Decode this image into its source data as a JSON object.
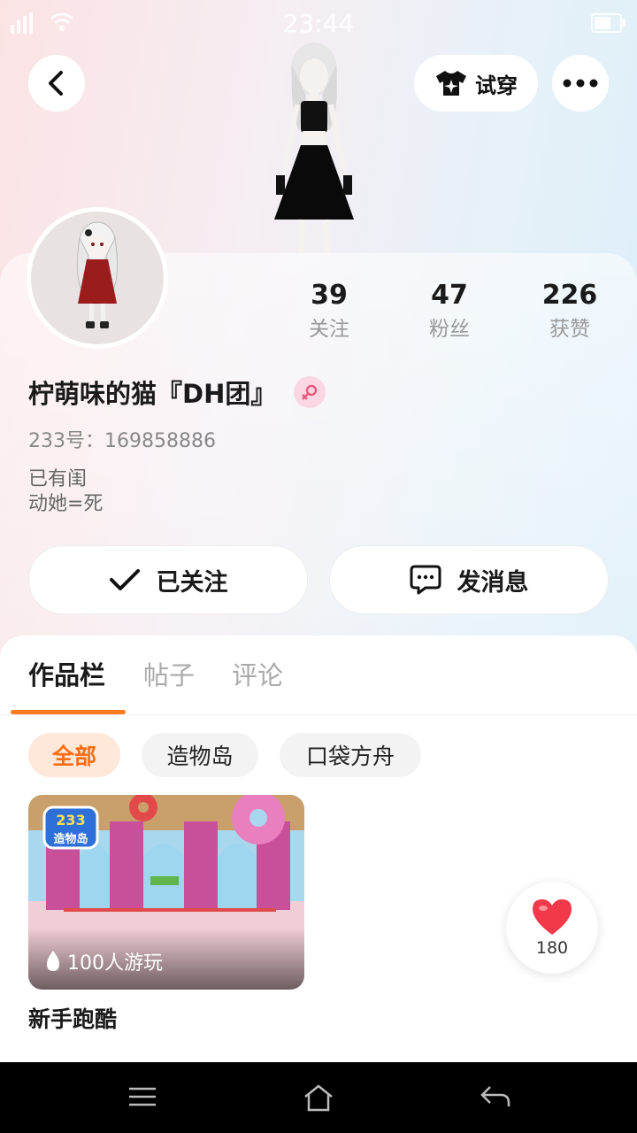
{
  "status_bar": {
    "time": "23:44"
  },
  "header": {
    "tryon_label": "试穿"
  },
  "profile": {
    "following_count": "39",
    "following_label": "关注",
    "followers_count": "47",
    "followers_label": "粉丝",
    "likes_count": "226",
    "likes_label": "获赞",
    "nickname": "柠萌味的猫『DH团』",
    "user_id": "233号：169858886",
    "bio_line1": "已有闺",
    "bio_line2": "动她=死"
  },
  "actions": {
    "follow_label": "已关注",
    "message_label": "发消息"
  },
  "tabs": [
    {
      "label": "作品栏"
    },
    {
      "label": "帖子"
    },
    {
      "label": "评论"
    }
  ],
  "filters": [
    {
      "label": "全部"
    },
    {
      "label": "造物岛"
    },
    {
      "label": "口袋方舟"
    }
  ],
  "works": [
    {
      "logo_top": "233",
      "logo_bottom": "造物岛",
      "players": "100人游玩",
      "title": "新手跑酷"
    }
  ],
  "like_button": {
    "count": "180"
  },
  "colors": {
    "accent": "#ff7a1f",
    "accent_chip_bg": "#fde8da",
    "heart": "#f2394a"
  },
  "icons": {
    "back": "chevron-left-icon",
    "tryon": "tshirt-sparkle-icon",
    "more": "more-dots-icon",
    "gender": "female-icon",
    "follow": "checkmark-icon",
    "message": "chat-bubble-icon",
    "players": "flame-icon",
    "like": "heart-icon",
    "nav_menu": "menu-icon",
    "nav_home": "home-icon",
    "nav_back": "back-arrow-icon"
  }
}
